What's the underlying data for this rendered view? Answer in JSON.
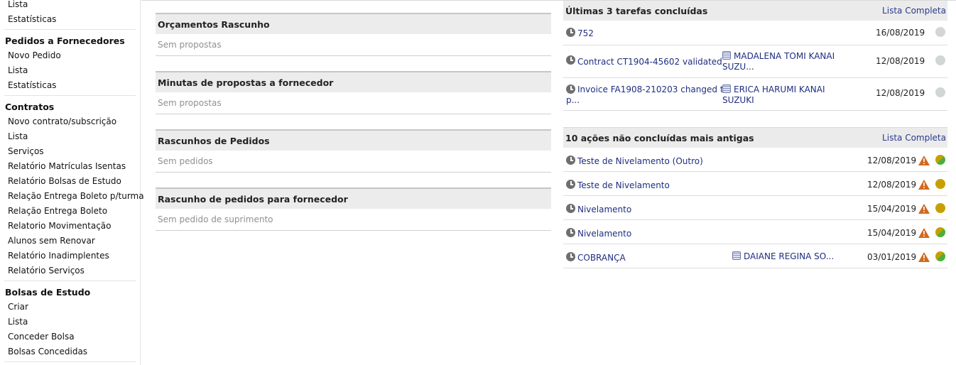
{
  "sidebar": {
    "top_links": [
      "Lista",
      "Estatísticas"
    ],
    "pedidos_fornecedores": {
      "title": "Pedidos a Fornecedores",
      "links": [
        "Novo Pedido",
        "Lista",
        "Estatísticas"
      ]
    },
    "contratos": {
      "title": "Contratos",
      "links": [
        "Novo contrato/subscrição",
        "Lista",
        "Serviços",
        "Relatório Matrículas Isentas",
        "Relatório Bolsas de Estudo",
        "Relação Entrega Boleto p/turma",
        "Relação Entrega Boleto",
        "Relatorio Movimentação",
        "Alunos sem Renovar",
        "Relatório Inadimplentes",
        "Relatório Serviços"
      ]
    },
    "bolsas": {
      "title": "Bolsas de Estudo",
      "links": [
        "Criar",
        "Lista",
        "Conceder Bolsa",
        "Bolsas Concedidas"
      ]
    }
  },
  "drafts": [
    {
      "title": "Orçamentos Rascunho",
      "empty": "Sem propostas"
    },
    {
      "title": "Minutas de propostas a fornecedor",
      "empty": "Sem propostas"
    },
    {
      "title": "Rascunhos de Pedidos",
      "empty": "Sem pedidos"
    },
    {
      "title": "Rascunho de pedidos para fornecedor",
      "empty": "Sem pedido de suprimento"
    }
  ],
  "completed": {
    "title": "Últimas 3 tarefas concluídas",
    "more": "Lista Completa",
    "rows": [
      {
        "label": "752",
        "who1": "",
        "who2": "",
        "date": "16/08/2019",
        "status": "grey"
      },
      {
        "label": "Contract CT1904-45602 validated",
        "who1": "MADALENA TOMI KANAI",
        "who2": "SUZU...",
        "date": "12/08/2019",
        "status": "grey"
      },
      {
        "label": "Invoice FA1908-210203 changed to",
        "label2": "p...",
        "who1": "ERICA HARUMI KANAI",
        "who2": "SUZUKI",
        "date": "12/08/2019",
        "status": "grey"
      }
    ]
  },
  "pending": {
    "title": "10 ações não concluídas mais antigas",
    "more": "Lista Completa",
    "rows": [
      {
        "label": "Teste de Nivelamento (Outro)",
        "who": "",
        "date": "12/08/2019",
        "status": "half"
      },
      {
        "label": "Teste de Nivelamento",
        "who": "",
        "date": "12/08/2019",
        "status": "gold"
      },
      {
        "label": "Nivelamento",
        "who": "",
        "date": "15/04/2019",
        "status": "gold"
      },
      {
        "label": "Nivelamento",
        "who": "",
        "date": "15/04/2019",
        "status": "half"
      },
      {
        "label": "COBRANÇA",
        "who": "DAIANE REGINA SO...",
        "date": "03/01/2019",
        "status": "half"
      }
    ]
  },
  "colors": {
    "link": "#1f2e80",
    "warning": "#d2691e",
    "late_gold": "#c6a000",
    "done_green": "#4bb03a"
  }
}
